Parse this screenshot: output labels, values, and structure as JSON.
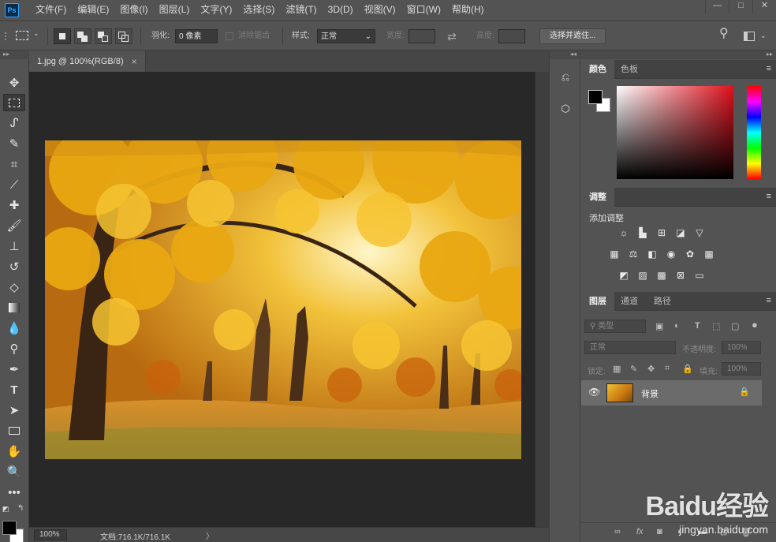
{
  "app": {
    "logo_text": "Ps"
  },
  "menu": [
    "文件(F)",
    "编辑(E)",
    "图像(I)",
    "图层(L)",
    "文字(Y)",
    "选择(S)",
    "滤镜(T)",
    "3D(D)",
    "视图(V)",
    "窗口(W)",
    "帮助(H)"
  ],
  "window_controls": {
    "minimize": "—",
    "restore": "□",
    "close": "✕"
  },
  "options": {
    "feather_label": "羽化:",
    "feather_value": "0 像素",
    "antialias_label": "消除锯齿",
    "style_label": "样式:",
    "style_value": "正常",
    "width_label": "宽度:",
    "height_label": "高度:",
    "select_mask_button": "选择并遮住..."
  },
  "document": {
    "tab_title": "1.jpg @ 100%(RGB/8)",
    "tab_close": "×",
    "zoom": "100%",
    "doc_info": "文档:716.1K/716.1K",
    "status_arrow": "〉"
  },
  "colors": {
    "foreground": "#000000",
    "background": "#ffffff",
    "panel": "#535353",
    "canvas_bg": "#282828"
  },
  "color_panel": {
    "tab_color": "颜色",
    "tab_swatches": "色板"
  },
  "adjust_panel": {
    "tab": "调整",
    "add_label": "添加调整"
  },
  "layers_panel": {
    "tab_layers": "图层",
    "tab_channels": "通道",
    "tab_paths": "路径",
    "filter_placeholder": "类型",
    "blend_mode": "正常",
    "opacity_label": "不透明度:",
    "opacity_value": "100%",
    "lock_label": "锁定:",
    "fill_label": "填充:",
    "fill_value": "100%",
    "layer_name": "背景",
    "bottom_fx": "fx"
  },
  "watermark": {
    "brand": "Baidu经验",
    "url": "jingyan.baidu.com"
  }
}
